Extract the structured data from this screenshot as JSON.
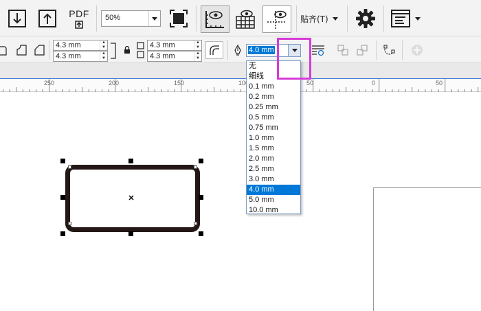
{
  "toolbar": {
    "pdf_label": "PDF",
    "zoom_value": "50%",
    "snap_label": "贴齐(T)",
    "colors": {
      "highlight": "#d63bd6",
      "selected": "#0078d7"
    }
  },
  "property_bar": {
    "corner_values": [
      "4.3 mm",
      "4.3 mm",
      "4.3 mm",
      "4.3 mm"
    ],
    "outline_width_value": "4.0 mm"
  },
  "outline_width_options": [
    "无",
    "细线",
    "0.1 mm",
    "0.2 mm",
    "0.25 mm",
    "0.5 mm",
    "0.75 mm",
    "1.0 mm",
    "1.5 mm",
    "2.0 mm",
    "2.5 mm",
    "3.0 mm",
    "4.0 mm",
    "5.0 mm",
    "10.0 mm"
  ],
  "selected_option": "4.0 mm",
  "ruler": {
    "labels": [
      "250",
      "200",
      "150",
      "100",
      "50",
      "0",
      "50"
    ]
  }
}
